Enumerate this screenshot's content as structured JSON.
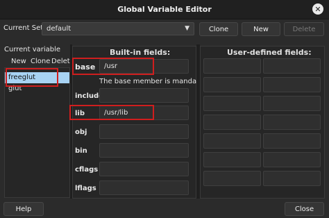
{
  "window": {
    "title": "Global Variable Editor"
  },
  "current_set": {
    "label": "Current Set:",
    "value": "default"
  },
  "top_buttons": {
    "clone": "Clone",
    "new": "New",
    "delete": "Delete"
  },
  "variables": {
    "header": "Current variable",
    "new": "New",
    "clone": "Clone",
    "delete": "Delete",
    "items": [
      "freeglut",
      "glut"
    ]
  },
  "builtin": {
    "title": "Built-in fields:",
    "fields": [
      {
        "name": "base",
        "value": "/usr"
      },
      {
        "name": "include",
        "value": ""
      },
      {
        "name": "lib",
        "value": "/usr/lib"
      },
      {
        "name": "obj",
        "value": ""
      },
      {
        "name": "bin",
        "value": ""
      },
      {
        "name": "cflags",
        "value": ""
      },
      {
        "name": "lflags",
        "value": ""
      }
    ],
    "message": "The base member is mandatory!"
  },
  "userdefined": {
    "title": "User-defined fields:"
  },
  "bottom": {
    "help": "Help",
    "close": "Close"
  },
  "icons": {
    "window_close": "close-icon",
    "combo_arrow": "chevron-down-icon"
  },
  "colors": {
    "selection": "#a8d3f3",
    "highlight": "#d01e1e"
  }
}
